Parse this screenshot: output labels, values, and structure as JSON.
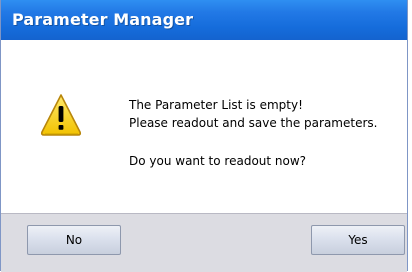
{
  "window": {
    "title": "Parameter Manager"
  },
  "dialog": {
    "icon": "warning-icon",
    "message_line1": "The Parameter List is empty!",
    "message_line2": "Please readout and save the parameters.",
    "question": "Do you want to readout now?"
  },
  "buttons": {
    "no_label": "No",
    "yes_label": "Yes"
  },
  "colors": {
    "titlebar": "#1f74e2",
    "footer": "#dcdce2",
    "warning_fill": "#f5d21a"
  }
}
